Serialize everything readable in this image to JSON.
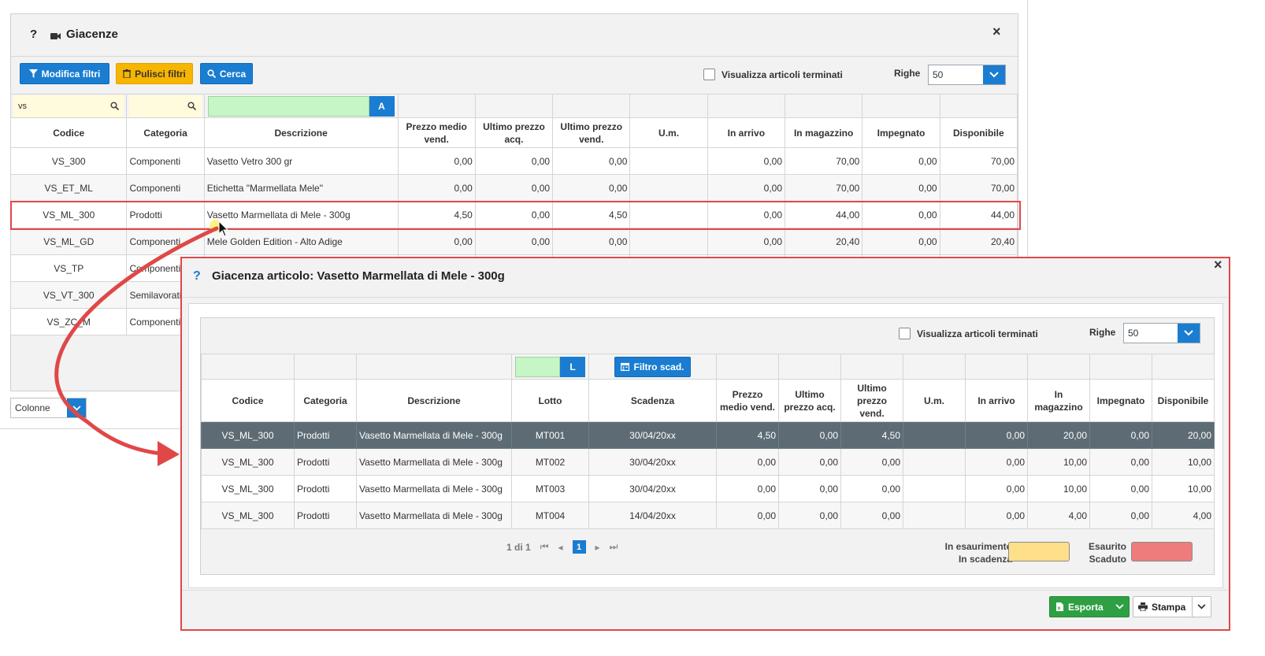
{
  "back_window": {
    "help": "?",
    "title": "Giacenze",
    "close": "×",
    "toolbar": {
      "edit_filters": "Modifica filtri",
      "clear_filters": "Pulisci filtri",
      "search": "Cerca",
      "show_terminated": "Visualizza articoli terminati",
      "rows_label": "Righe",
      "rows_value": "50"
    },
    "filters": {
      "codice": "vs",
      "a_button": "A"
    },
    "columns": [
      "Codice",
      "Categoria",
      "Descrizione",
      "Prezzo medio vend.",
      "Ultimo prezzo acq.",
      "Ultimo prezzo vend.",
      "U.m.",
      "In arrivo",
      "In magazzino",
      "Impegnato",
      "Disponibile"
    ],
    "rows": [
      [
        "VS_300",
        "Componenti",
        "Vasetto Vetro 300 gr",
        "0,00",
        "0,00",
        "0,00",
        "",
        "0,00",
        "70,00",
        "0,00",
        "70,00"
      ],
      [
        "VS_ET_ML",
        "Componenti",
        "Etichetta \"Marmellata Mele\"",
        "0,00",
        "0,00",
        "0,00",
        "",
        "0,00",
        "70,00",
        "0,00",
        "70,00"
      ],
      [
        "VS_ML_300",
        "Prodotti",
        "Vasetto Marmellata di Mele - 300g",
        "4,50",
        "0,00",
        "4,50",
        "",
        "0,00",
        "44,00",
        "0,00",
        "44,00"
      ],
      [
        "VS_ML_GD",
        "Componenti",
        "Mele Golden Edition - Alto Adige",
        "0,00",
        "0,00",
        "0,00",
        "",
        "0,00",
        "20,40",
        "0,00",
        "20,40"
      ],
      [
        "VS_TP",
        "Componenti",
        "",
        "",
        "",
        "",
        "",
        "",
        "",
        "",
        ""
      ],
      [
        "VS_VT_300",
        "Semilavorati",
        "",
        "",
        "",
        "",
        "",
        "",
        "",
        "",
        ""
      ],
      [
        "VS_ZC_M",
        "Componenti",
        "",
        "",
        "",
        "",
        "",
        "",
        "",
        "",
        ""
      ]
    ],
    "columns_button": "Colonne"
  },
  "modal": {
    "help": "?",
    "title": "Giacenza articolo: Vasetto Marmellata di Mele - 300g",
    "close": "×",
    "show_terminated": "Visualizza articoli terminati",
    "rows_label": "Righe",
    "rows_value": "50",
    "filters": {
      "l_button": "L",
      "expiry_filter": "Filtro scad."
    },
    "columns": [
      "Codice",
      "Categoria",
      "Descrizione",
      "Lotto",
      "Scadenza",
      "Prezzo medio vend.",
      "Ultimo prezzo acq.",
      "Ultimo prezzo vend.",
      "U.m.",
      "In arrivo",
      "In magazzino",
      "Impegnato",
      "Disponibile"
    ],
    "rows": [
      [
        "VS_ML_300",
        "Prodotti",
        "Vasetto Marmellata di Mele - 300g",
        "MT001",
        "30/04/20xx",
        "4,50",
        "0,00",
        "4,50",
        "",
        "0,00",
        "20,00",
        "0,00",
        "20,00"
      ],
      [
        "VS_ML_300",
        "Prodotti",
        "Vasetto Marmellata di Mele - 300g",
        "MT002",
        "30/04/20xx",
        "0,00",
        "0,00",
        "0,00",
        "",
        "0,00",
        "10,00",
        "0,00",
        "10,00"
      ],
      [
        "VS_ML_300",
        "Prodotti",
        "Vasetto Marmellata di Mele - 300g",
        "MT003",
        "30/04/20xx",
        "0,00",
        "0,00",
        "0,00",
        "",
        "0,00",
        "10,00",
        "0,00",
        "10,00"
      ],
      [
        "VS_ML_300",
        "Prodotti",
        "Vasetto Marmellata di Mele - 300g",
        "MT004",
        "14/04/20xx",
        "0,00",
        "0,00",
        "0,00",
        "",
        "0,00",
        "4,00",
        "0,00",
        "4,00"
      ]
    ],
    "pager": {
      "info": "1 di 1",
      "current": "1"
    },
    "legend": {
      "low_label_1": "In esaurimento",
      "low_label_2": "In scadenza",
      "low_color": "#ffe08a",
      "out_label_1": "Esaurito",
      "out_label_2": "Scaduto",
      "out_color": "#ef7c7c"
    },
    "footer": {
      "export": "Esporta",
      "print": "Stampa"
    }
  },
  "colors": {
    "accent_blue": "#1a7dd1",
    "highlight_red": "#e04848",
    "selected_row": "#5d6c74",
    "filter_yellow": "#fffbdc",
    "filter_green": "#c6f5c6"
  }
}
